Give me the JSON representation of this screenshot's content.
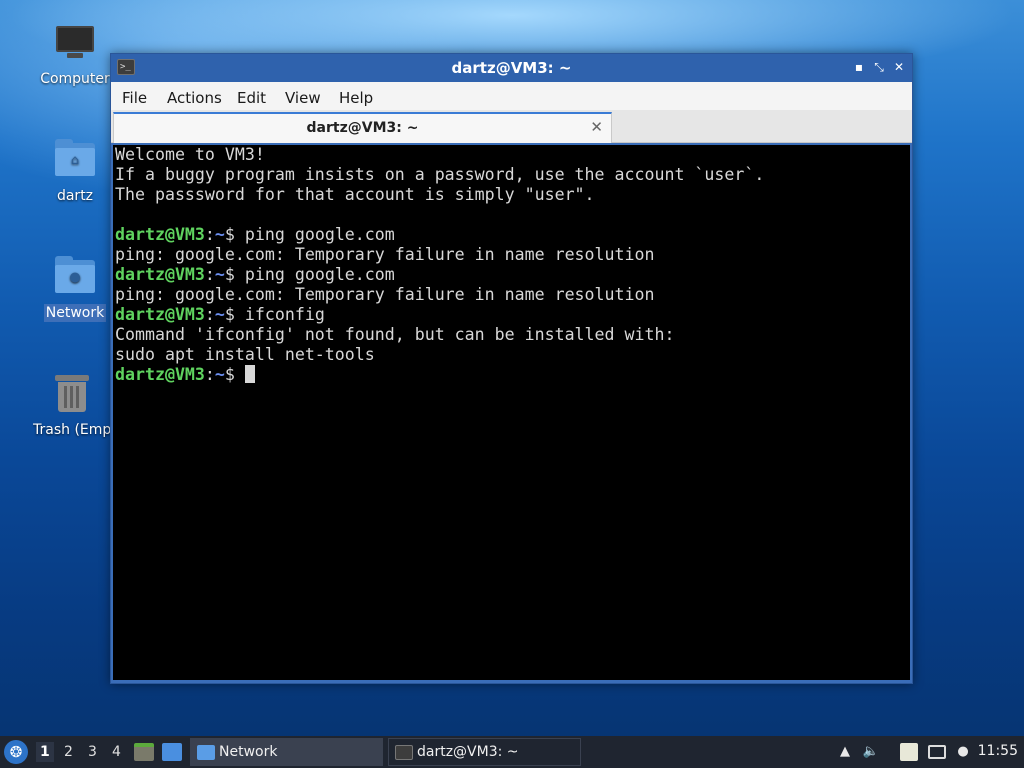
{
  "desktop": {
    "icons": [
      {
        "label": "Computer",
        "icon": "computer-icon"
      },
      {
        "label": "dartz",
        "icon": "home-folder-icon"
      },
      {
        "label": "Network",
        "icon": "network-folder-icon",
        "selected": true
      },
      {
        "label": "Trash (Empty)",
        "icon": "trash-icon"
      }
    ]
  },
  "window": {
    "title": "dartz@VM3: ~",
    "app_icon": "terminal-icon",
    "controls": {
      "minimize": "▪",
      "restore": "⤡",
      "close": "✕"
    },
    "menu": [
      "File",
      "Actions",
      "Edit",
      "View",
      "Help"
    ],
    "tab": {
      "label": "dartz@VM3: ~",
      "close": "✕"
    }
  },
  "terminal": {
    "prompt": {
      "user_host": "dartz@VM3",
      "sep": ":",
      "path": "~",
      "symbol": "$ "
    },
    "lines": [
      {
        "type": "out",
        "text": "Welcome to VM3!"
      },
      {
        "type": "out",
        "text": "If a buggy program insists on a password, use the account `user`."
      },
      {
        "type": "out",
        "text": "The passsword for that account is simply \"user\"."
      },
      {
        "type": "out",
        "text": ""
      },
      {
        "type": "cmd",
        "text": "ping google.com"
      },
      {
        "type": "out",
        "text": "ping: google.com: Temporary failure in name resolution"
      },
      {
        "type": "cmd",
        "text": "ping google.com"
      },
      {
        "type": "out",
        "text": "ping: google.com: Temporary failure in name resolution"
      },
      {
        "type": "cmd",
        "text": "ifconfig"
      },
      {
        "type": "out",
        "text": "Command 'ifconfig' not found, but can be installed with:"
      },
      {
        "type": "out",
        "text": "sudo apt install net-tools"
      },
      {
        "type": "cmd",
        "text": "",
        "cursor": true
      }
    ],
    "colors": {
      "user": "#5fd35f",
      "path": "#6b8ff0",
      "text": "#d8d8d8",
      "background": "#000000"
    }
  },
  "taskbar": {
    "workspaces": [
      "1",
      "2",
      "3",
      "4"
    ],
    "active_workspace": "1",
    "tasks": [
      {
        "label": "Network",
        "icon": "folder-icon"
      },
      {
        "label": "dartz@VM3: ~",
        "icon": "terminal-icon"
      }
    ],
    "clock": "11:55"
  }
}
